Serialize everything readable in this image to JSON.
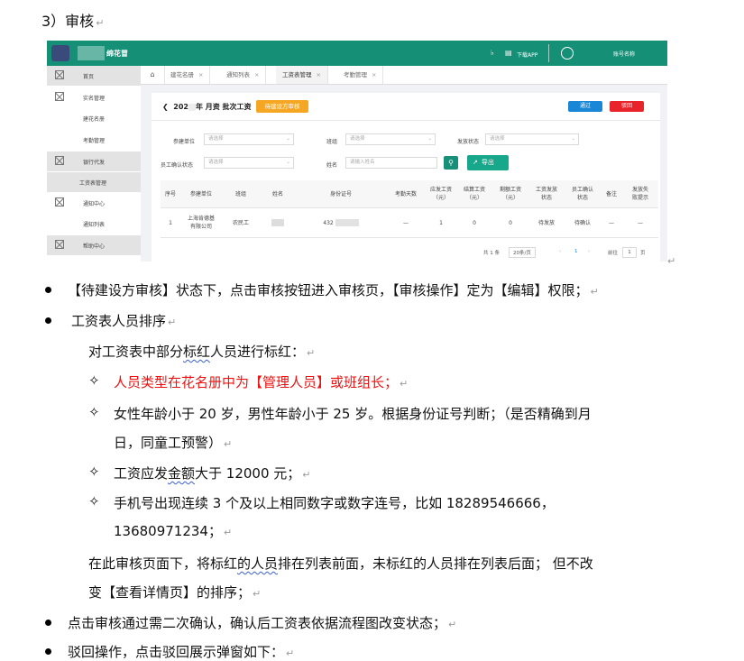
{
  "doc": {
    "heading": "3）审核",
    "bullets": [
      {
        "text": "【待建设方审核】状态下，点击审核按钮进入审核页，【审核操作】定为【编辑】权限；"
      },
      {
        "text": "工资表人员排序"
      }
    ],
    "sort_intro": {
      "pre": "对工资表中部分",
      "wavy": "标红",
      "post": "人员进行标红："
    },
    "rules": [
      {
        "text": "人员类型在花名册中为【管理人员】或班组长；",
        "color": "#e11111"
      },
      {
        "text": "女性年龄小于 20 岁，男性年龄小于 25 岁。根据身份证号判断；（是否精确到月"
      },
      {
        "text": "日，同童工预警）"
      },
      {
        "pre": "工资应发",
        "wavy": "金额",
        "post": "大于 12000 元；"
      },
      {
        "text": "手机号出现连续 3 个及以上相同数字或数字连号，比如 18289546666，"
      },
      {
        "text": "13680971234；"
      }
    ],
    "sort_note_1": {
      "pre": "在此审核页面下，将标红",
      "wavy": "的人员",
      "post": "排在列表前面，未标红的人员排在列表后面；  但不改"
    },
    "sort_note_2": "变【查看详情页】的排序；",
    "bullets2": [
      "点击审核通过需二次确认，确认后工资表依据流程图改变状态；",
      "驳回操作，点击驳回展示弹窗如下："
    ],
    "return_mark": "↵"
  },
  "app": {
    "header": {
      "app_name": "绵花冒",
      "download_label": "下载APP",
      "account_label": "账号名称",
      "bell_icon": "bell-icon",
      "doc_icon": "document-icon",
      "user_icon": "user-circle-icon"
    },
    "sidebar": [
      {
        "label": "首页",
        "icon": "broken-image-icon",
        "selected": true
      },
      {
        "label": "实名管理",
        "icon": "broken-image-icon",
        "selected": false
      },
      {
        "label": "建花名册",
        "icon": "",
        "selected": false
      },
      {
        "label": "考勤管理",
        "icon": "",
        "selected": false
      },
      {
        "label": "银行代发",
        "icon": "broken-image-icon",
        "selected": true
      },
      {
        "label": "工资表管理",
        "icon": "",
        "selected": true
      },
      {
        "label": "通知中心",
        "icon": "broken-image-icon",
        "selected": false
      },
      {
        "label": "通知列表",
        "icon": "",
        "selected": false
      },
      {
        "label": "帮助中心",
        "icon": "broken-image-icon",
        "selected": true
      }
    ],
    "tabs": [
      {
        "label": "建花名册"
      },
      {
        "label": "通知列表"
      },
      {
        "label": "工资表管理",
        "active": true
      },
      {
        "label": "考勤管理"
      }
    ],
    "page": {
      "back_icon": "chevron-left-icon",
      "title_prefix": "202",
      "title_suffix": "年  月资  批次工资",
      "status": "待建设方审核",
      "approve": "通过",
      "reject": "驳回"
    },
    "filters": {
      "unit_label": "参建单位",
      "unit_placeholder": "请选择",
      "team_label": "班组",
      "team_placeholder": "请选择",
      "pay_status_label": "发放状态",
      "pay_status_placeholder": "请选择",
      "confirm_label": "员工确认状态",
      "confirm_placeholder": "请选择",
      "name_label": "姓名",
      "name_placeholder": "请输入姓名",
      "export_label": "导出"
    },
    "table": {
      "headers": [
        "序号",
        "参建单位",
        "班组",
        "姓名",
        "身份证号",
        "考勤天数",
        "应发工资\n（元）",
        "结算工资\n（元）",
        "剩额工资\n（元）",
        "工资发放\n状态",
        "员工确认\n状态",
        "备注",
        "发放失\n败提示"
      ],
      "rows": [
        [
          "1",
          "上海肯德基\n有限公司",
          "农民工",
          "",
          "432",
          "—",
          "1",
          "0",
          "0",
          "待发放",
          "待确认",
          "—",
          "—"
        ]
      ]
    },
    "pager": {
      "total": "共 1 条",
      "size": "20条/页",
      "current": "1",
      "goto_label": "前往",
      "goto_value": "1",
      "page_unit": "页"
    }
  }
}
